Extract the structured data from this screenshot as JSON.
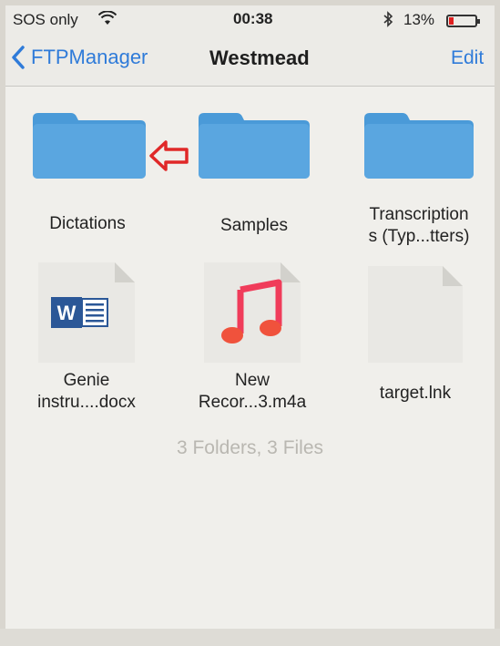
{
  "status_bar": {
    "carrier": "SOS only",
    "time": "00:38",
    "battery_percent": "13%",
    "battery_level": 0.13,
    "battery_color": "#e02020"
  },
  "nav": {
    "back_label": "FTPManager",
    "title": "Westmead",
    "edit_label": "Edit"
  },
  "folders": [
    {
      "line1": "Dictations",
      "line2": "",
      "highlighted": true
    },
    {
      "line1": "Samples",
      "line2": ""
    },
    {
      "line1": "Transcription",
      "line2": "s (Typ...tters)"
    }
  ],
  "files": [
    {
      "line1": "Genie",
      "line2": "instru....docx",
      "icon": "word-icon"
    },
    {
      "line1": "New",
      "line2": "Recor...3.m4a",
      "icon": "music-icon"
    },
    {
      "line1": "target.lnk",
      "line2": "",
      "icon": "blank-file-icon"
    }
  ],
  "summary": "3 Folders, 3 Files",
  "colors": {
    "accent": "#2f7bd9",
    "folder": "#4a9ad8",
    "arrow": "#e02828"
  }
}
